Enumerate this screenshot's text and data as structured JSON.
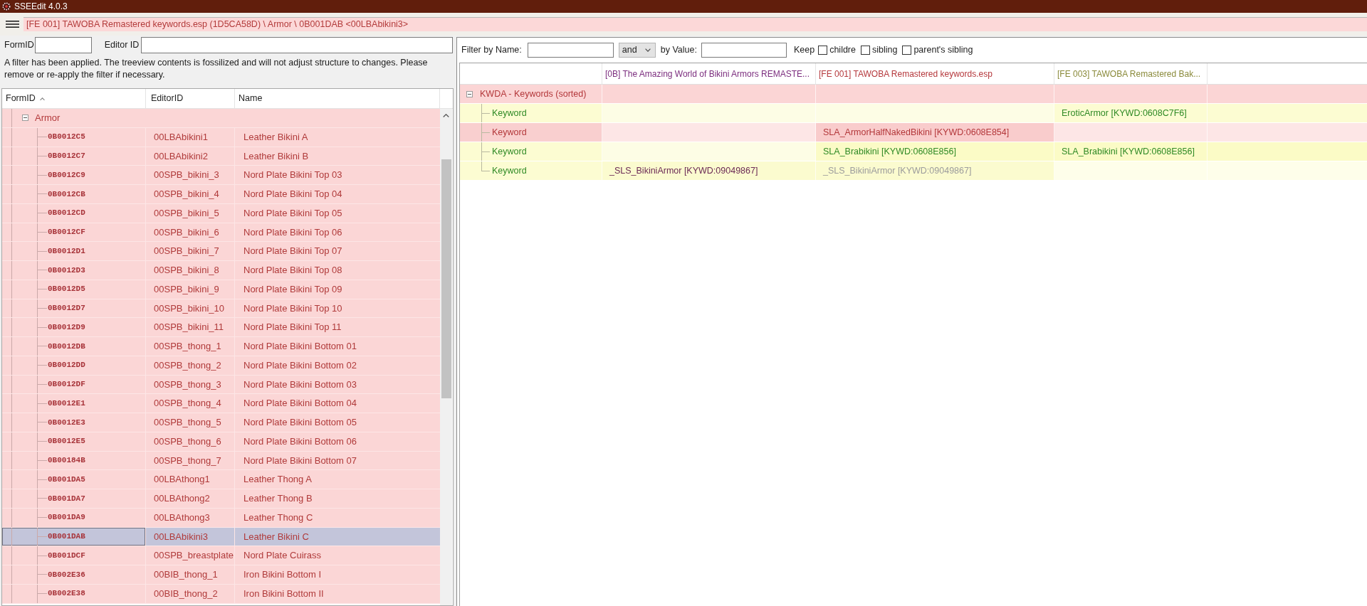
{
  "window": {
    "title": "SSEEdit 4.0.3"
  },
  "path_bar": {
    "text": "[FE 001] TAWOBA Remastered keywords.esp (1D5CA58D) \\ Armor \\ 0B001DAB <00LBAbikini3>"
  },
  "left_filter": {
    "form_id_label": "FormID",
    "editor_id_label": "Editor ID",
    "notice": "A filter has been applied. The treeview contents is fossilized and will not adjust structure to changes. Please remove or re-apply the filter if necessary."
  },
  "tree": {
    "columns": [
      {
        "label": "FormID",
        "sorted": true
      },
      {
        "label": "EditorID",
        "sorted": false
      },
      {
        "label": "Name",
        "sorted": false
      }
    ],
    "nodes": [
      {
        "label": "Armor",
        "expanded": true,
        "children": [
          {
            "form_id": "0B0012C5",
            "editor_id": "00LBAbikini1",
            "name": "Leather Bikini A",
            "selected": false
          },
          {
            "form_id": "0B0012C7",
            "editor_id": "00LBAbikini2",
            "name": "Leather Bikini B",
            "selected": false
          },
          {
            "form_id": "0B0012C9",
            "editor_id": "00SPB_bikini_3",
            "name": "Nord Plate Bikini Top 03",
            "selected": false
          },
          {
            "form_id": "0B0012CB",
            "editor_id": "00SPB_bikini_4",
            "name": "Nord Plate Bikini Top 04",
            "selected": false
          },
          {
            "form_id": "0B0012CD",
            "editor_id": "00SPB_bikini_5",
            "name": "Nord Plate Bikini Top 05",
            "selected": false
          },
          {
            "form_id": "0B0012CF",
            "editor_id": "00SPB_bikini_6",
            "name": "Nord Plate Bikini Top 06",
            "selected": false
          },
          {
            "form_id": "0B0012D1",
            "editor_id": "00SPB_bikini_7",
            "name": "Nord Plate Bikini Top 07",
            "selected": false
          },
          {
            "form_id": "0B0012D3",
            "editor_id": "00SPB_bikini_8",
            "name": "Nord Plate Bikini Top 08",
            "selected": false
          },
          {
            "form_id": "0B0012D5",
            "editor_id": "00SPB_bikini_9",
            "name": "Nord Plate Bikini Top 09",
            "selected": false
          },
          {
            "form_id": "0B0012D7",
            "editor_id": "00SPB_bikini_10",
            "name": "Nord Plate Bikini Top 10",
            "selected": false
          },
          {
            "form_id": "0B0012D9",
            "editor_id": "00SPB_bikini_11",
            "name": "Nord Plate Bikini Top 11",
            "selected": false
          },
          {
            "form_id": "0B0012DB",
            "editor_id": "00SPB_thong_1",
            "name": "Nord Plate Bikini Bottom 01",
            "selected": false
          },
          {
            "form_id": "0B0012DD",
            "editor_id": "00SPB_thong_2",
            "name": "Nord Plate Bikini Bottom 02",
            "selected": false
          },
          {
            "form_id": "0B0012DF",
            "editor_id": "00SPB_thong_3",
            "name": "Nord Plate Bikini Bottom 03",
            "selected": false
          },
          {
            "form_id": "0B0012E1",
            "editor_id": "00SPB_thong_4",
            "name": "Nord Plate Bikini Bottom 04",
            "selected": false
          },
          {
            "form_id": "0B0012E3",
            "editor_id": "00SPB_thong_5",
            "name": "Nord Plate Bikini Bottom 05",
            "selected": false
          },
          {
            "form_id": "0B0012E5",
            "editor_id": "00SPB_thong_6",
            "name": "Nord Plate Bikini Bottom 06",
            "selected": false
          },
          {
            "form_id": "0B00184B",
            "editor_id": "00SPB_thong_7",
            "name": "Nord Plate Bikini Bottom 07",
            "selected": false
          },
          {
            "form_id": "0B001DA5",
            "editor_id": "00LBAthong1",
            "name": "Leather Thong A",
            "selected": false
          },
          {
            "form_id": "0B001DA7",
            "editor_id": "00LBAthong2",
            "name": "Leather Thong B",
            "selected": false
          },
          {
            "form_id": "0B001DA9",
            "editor_id": "00LBAthong3",
            "name": "Leather Thong C",
            "selected": false
          },
          {
            "form_id": "0B001DAB",
            "editor_id": "00LBAbikini3",
            "name": "Leather Bikini C",
            "selected": true
          },
          {
            "form_id": "0B001DCF",
            "editor_id": "00SPB_breastplate",
            "name": "Nord Plate Cuirass",
            "selected": false
          },
          {
            "form_id": "0B002E36",
            "editor_id": "00BIB_thong_1",
            "name": "Iron Bikini Bottom I",
            "selected": false
          },
          {
            "form_id": "0B002E38",
            "editor_id": "00BIB_thong_2",
            "name": "Iron Bikini Bottom II",
            "selected": false
          }
        ]
      }
    ]
  },
  "record_filter": {
    "name_label": "Filter by Name:",
    "operator": "and",
    "value_label": "by Value:",
    "keep_label": "Keep",
    "keep_options": [
      {
        "label": "childre",
        "checked": false
      },
      {
        "label": "sibling",
        "checked": false
      },
      {
        "label": "parent's sibling",
        "checked": false
      }
    ]
  },
  "record_view": {
    "columns": [
      {
        "label": "[0B] The Amazing World of Bikini Armors REMASTE...",
        "color": "#7b2d7e"
      },
      {
        "label": "[FE 001] TAWOBA Remastered keywords.esp",
        "color": "#b5383c"
      },
      {
        "label": "[FE 003] TAWOBA Remastered Bak...",
        "color": "#8a8a3a"
      }
    ],
    "rows": [
      {
        "label": "KWDA - Keywords (sorted)",
        "kind": "conflict",
        "color": "#fbd5d5",
        "expanded": true,
        "cells": [
          {
            "color": "#fbd5d5"
          },
          {
            "color": "#fbd5d5"
          },
          {
            "color": "#fbd5d5"
          }
        ],
        "children": [
          {
            "label": "Keyword",
            "kind": "override",
            "color": "#fcfcd2",
            "cells": [
              {
                "color": "#fdfde5"
              },
              {
                "color": "#fdfde5"
              },
              {
                "text": "EroticArmor [KYWD:0608C7F6]",
                "kind": "override",
                "color": "#fcfcd2"
              }
            ]
          },
          {
            "label": "Keyword",
            "kind": "conflict",
            "color": "#f9cfcf",
            "cells": [
              {
                "color": "#fde6e6"
              },
              {
                "text": "SLA_ArmorHalfNakedBikini [KYWD:0608E854]",
                "kind": "conflict",
                "color": "#f9cccc"
              },
              {
                "color": "#fde6e6"
              }
            ]
          },
          {
            "label": "Keyword",
            "kind": "override",
            "color": "#fcfcd2",
            "cells": [
              {
                "color": "#fdfde5"
              },
              {
                "text": "SLA_Brabikini [KYWD:0608E856]",
                "kind": "override",
                "color": "#fbfbc6"
              },
              {
                "text": "SLA_Brabikini [KYWD:0608E856]",
                "kind": "override",
                "color": "#fbfbc6"
              }
            ]
          },
          {
            "label": "Keyword",
            "kind": "override",
            "color": "#fcfcd2",
            "cells": [
              {
                "text": "_SLS_BikiniArmor [KYWD:09049867]",
                "kind": "master",
                "color": "#fbfbcf"
              },
              {
                "text": "_SLS_BikiniArmor [KYWD:09049867]",
                "kind": "identical",
                "color": "#fbfbcf"
              },
              {
                "color": "#fefeea"
              }
            ]
          }
        ]
      }
    ]
  }
}
